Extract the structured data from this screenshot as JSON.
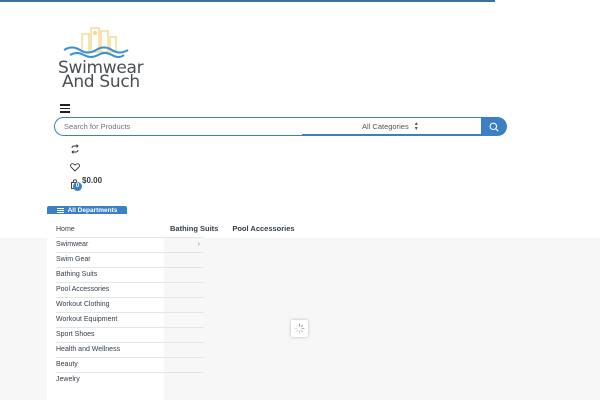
{
  "logo": {
    "line1": "Swimwear",
    "line2": "And Such"
  },
  "search": {
    "placeholder": "Search for Products",
    "category_selected": "All Categories"
  },
  "header": {
    "cart_total": "$0.00",
    "cart_count": "0"
  },
  "departments": {
    "button_label": "All Departments",
    "items": [
      {
        "label": "Home"
      },
      {
        "label": "Swimwear"
      },
      {
        "label": "Swim Gear"
      },
      {
        "label": "Bathing Suits"
      },
      {
        "label": "Pool Accessories"
      },
      {
        "label": "Workout Clothing"
      },
      {
        "label": "Workout Equipment"
      },
      {
        "label": "Sport Shoes"
      },
      {
        "label": "Health and Wellness"
      },
      {
        "label": "Beauty"
      },
      {
        "label": "Jewelry"
      }
    ]
  },
  "nav": {
    "links": [
      {
        "label": "Bathing Suits"
      },
      {
        "label": "Pool Accessories"
      }
    ]
  },
  "colors": {
    "accent": "#3b7fc4",
    "text": "#333e48",
    "logo_water": "#3a8fd6",
    "logo_buildings": "#f2d78c"
  }
}
